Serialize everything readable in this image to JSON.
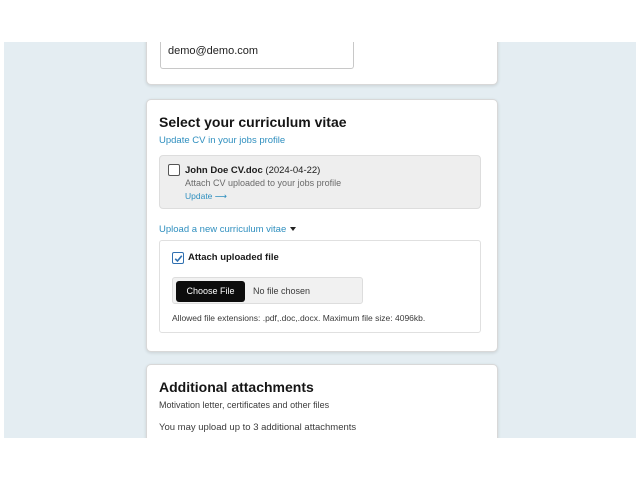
{
  "email_section": {
    "email_value": "demo@demo.com"
  },
  "cv_section": {
    "title": "Select your curriculum vitae",
    "update_profile_link": "Update CV in your jobs profile",
    "existing_cv": {
      "file_name": "John Doe CV.doc",
      "date": "(2024-04-22)",
      "description": "Attach CV uploaded to your jobs profile",
      "update_link": "Update ⟶"
    },
    "upload_toggle": "Upload a new curriculum vitae",
    "upload": {
      "attach_label": "Attach uploaded file",
      "attach_checked": true,
      "choose_button": "Choose File",
      "file_status": "No file chosen",
      "allowed_text": "Allowed file extensions: .pdf,.doc,.docx. Maximum file size: 4096kb."
    }
  },
  "attachments_section": {
    "title": "Additional attachments",
    "subtitle": "Motivation letter, certificates and other files",
    "limit_text": "You may upload up to 3 additional attachments"
  },
  "colors": {
    "accent": "#2f8fbf",
    "page_background": "#e4edf2",
    "checkbox_checked": "#2f6fb0"
  }
}
